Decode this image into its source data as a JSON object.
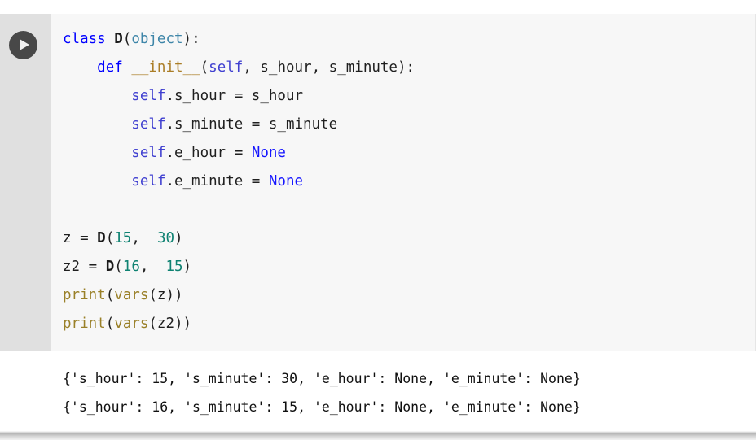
{
  "cell": {
    "run_button": {
      "icon": "play-icon",
      "tooltip": "Run cell"
    },
    "language": "python",
    "code_lines": [
      [
        {
          "text": "class ",
          "token": "keyword"
        },
        {
          "text": "D",
          "token": "class-name"
        },
        {
          "text": "(",
          "token": "punctuation"
        },
        {
          "text": "object",
          "token": "builtin"
        },
        {
          "text": "):",
          "token": "punctuation"
        }
      ],
      [
        {
          "text": "    ",
          "token": "plain"
        },
        {
          "text": "def ",
          "token": "keyword"
        },
        {
          "text": "__init__",
          "token": "function-name"
        },
        {
          "text": "(",
          "token": "punctuation"
        },
        {
          "text": "self",
          "token": "self"
        },
        {
          "text": ", s_hour, s_minute):",
          "token": "plain"
        }
      ],
      [
        {
          "text": "        ",
          "token": "plain"
        },
        {
          "text": "self",
          "token": "self"
        },
        {
          "text": ".s_hour = s_hour",
          "token": "plain"
        }
      ],
      [
        {
          "text": "        ",
          "token": "plain"
        },
        {
          "text": "self",
          "token": "self"
        },
        {
          "text": ".s_minute = s_minute",
          "token": "plain"
        }
      ],
      [
        {
          "text": "        ",
          "token": "plain"
        },
        {
          "text": "self",
          "token": "self"
        },
        {
          "text": ".e_hour = ",
          "token": "plain"
        },
        {
          "text": "None",
          "token": "none"
        }
      ],
      [
        {
          "text": "        ",
          "token": "plain"
        },
        {
          "text": "self",
          "token": "self"
        },
        {
          "text": ".e_minute = ",
          "token": "plain"
        },
        {
          "text": "None",
          "token": "none"
        }
      ],
      [],
      [
        {
          "text": "z = ",
          "token": "plain"
        },
        {
          "text": "D",
          "token": "class-name"
        },
        {
          "text": "(",
          "token": "punctuation"
        },
        {
          "text": "15",
          "token": "number"
        },
        {
          "text": ",  ",
          "token": "punctuation"
        },
        {
          "text": "30",
          "token": "number"
        },
        {
          "text": ")",
          "token": "punctuation"
        }
      ],
      [
        {
          "text": "z2 = ",
          "token": "plain"
        },
        {
          "text": "D",
          "token": "class-name"
        },
        {
          "text": "(",
          "token": "punctuation"
        },
        {
          "text": "16",
          "token": "number"
        },
        {
          "text": ",  ",
          "token": "punctuation"
        },
        {
          "text": "15",
          "token": "number"
        },
        {
          "text": ")",
          "token": "punctuation"
        }
      ],
      [
        {
          "text": "print",
          "token": "call"
        },
        {
          "text": "(",
          "token": "punctuation"
        },
        {
          "text": "vars",
          "token": "call"
        },
        {
          "text": "(z))",
          "token": "punctuation"
        }
      ],
      [
        {
          "text": "print",
          "token": "call"
        },
        {
          "text": "(",
          "token": "punctuation"
        },
        {
          "text": "vars",
          "token": "call"
        },
        {
          "text": "(z2))",
          "token": "punctuation"
        }
      ]
    ],
    "output_lines": [
      "{'s_hour': 15, 's_minute': 30, 'e_hour': None, 'e_minute': None}",
      "{'s_hour': 16, 's_minute': 15, 'e_hour': None, 'e_minute': None}"
    ]
  },
  "colors": {
    "gutter_background": "#e0e0e0",
    "editor_background": "#f7f7f7",
    "output_background": "#ffffff",
    "run_button": "#484848",
    "keyword": "#0000ff",
    "class_name": "#1a1a1a",
    "builtin": "#3d85a8",
    "function_name": "#aa7d26",
    "self": "#4040d0",
    "none_literal": "#1414ff",
    "number": "#0f8272",
    "call": "#9a8028",
    "plain_text": "#1f1f1f",
    "output_text": "#101010"
  }
}
